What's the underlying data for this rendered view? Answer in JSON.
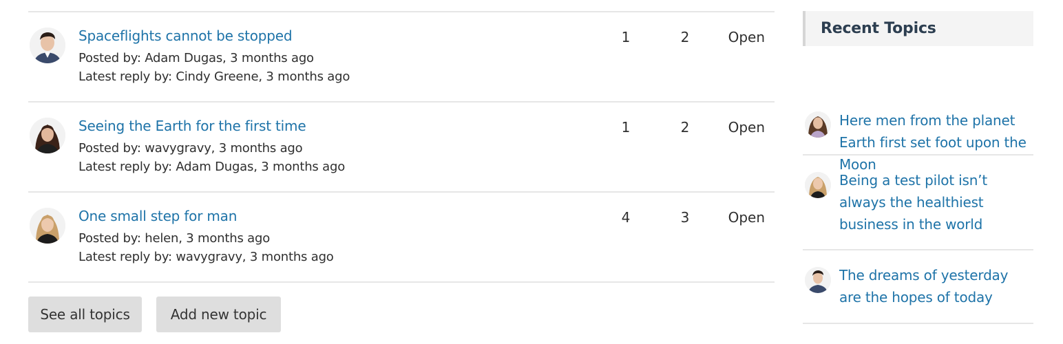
{
  "topics": [
    {
      "title": "Spaceflights cannot be stopped",
      "posted": "Posted by: Adam Dugas, 3 months ago",
      "latest": "Latest reply by: Cindy Greene, 3 months ago",
      "replies": "1",
      "views": "2",
      "status": "Open"
    },
    {
      "title": "Seeing the Earth for the first time",
      "posted": "Posted by: wavygravy, 3 months ago",
      "latest": "Latest reply by: Adam Dugas, 3 months ago",
      "replies": "1",
      "views": "2",
      "status": "Open"
    },
    {
      "title": "One small step for man",
      "posted": "Posted by: helen, 3 months ago",
      "latest": "Latest reply by: wavygravy, 3 months ago",
      "replies": "4",
      "views": "3",
      "status": "Open"
    }
  ],
  "actions": {
    "see_all": "See all topics",
    "add_new": "Add new topic"
  },
  "sidebar": {
    "title": "Recent Topics",
    "items": [
      {
        "label": "Here men from the planet Earth first set foot upon the Moon"
      },
      {
        "label": "Being a test pilot isn’t always the healthiest business in the world"
      },
      {
        "label": "The dreams of yesterday are the hopes of today"
      }
    ]
  },
  "colors": {
    "link": "#1e73a8",
    "divider": "#e6e6e6",
    "button_bg": "#dedede",
    "sidebar_header_bg": "#f4f4f4"
  }
}
